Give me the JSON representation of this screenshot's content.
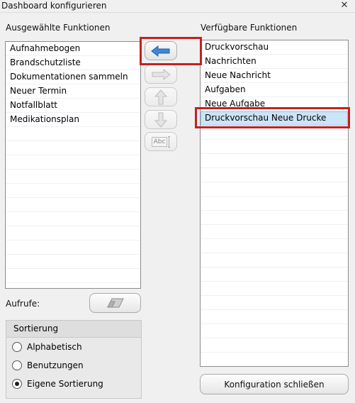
{
  "window": {
    "title": "Dashboard konfigurieren",
    "close_glyph": "✕"
  },
  "selected": {
    "label": "Ausgewählte Funktionen",
    "items": [
      "Aufnahmebogen",
      "Brandschutzliste",
      "Dokumentationen sammeln",
      "Neuer Termin",
      "Notfallblatt",
      "Medikationsplan"
    ]
  },
  "available": {
    "label": "Verfügbare Funktionen",
    "items": [
      "Druckvorschau",
      "Nachrichten",
      "Neue Nachricht",
      "Aufgaben",
      "Neue Aufgabe",
      "Druckvorschau Neue Drucke"
    ],
    "selected_item": "Druckvorschau Neue Drucke"
  },
  "toolbar": {
    "add_icon": "arrow-left-icon",
    "remove_icon": "arrow-right-icon",
    "up_icon": "arrow-up-icon",
    "down_icon": "arrow-down-icon",
    "rename_icon": "rename-icon",
    "rename_glyph": "Abc"
  },
  "calls": {
    "label": "Aufrufe:",
    "clear_icon": "eraser-icon"
  },
  "sorting": {
    "title": "Sortierung",
    "options": [
      "Alphabetisch",
      "Benutzungen",
      "Eigene Sortierung"
    ],
    "selected": "Eigene Sortierung"
  },
  "close_button": {
    "label": "Konfiguration schließen"
  },
  "colors": {
    "accent_arrow": "#3f86d8",
    "selection": "#cce4f7",
    "highlight": "#c42020"
  }
}
